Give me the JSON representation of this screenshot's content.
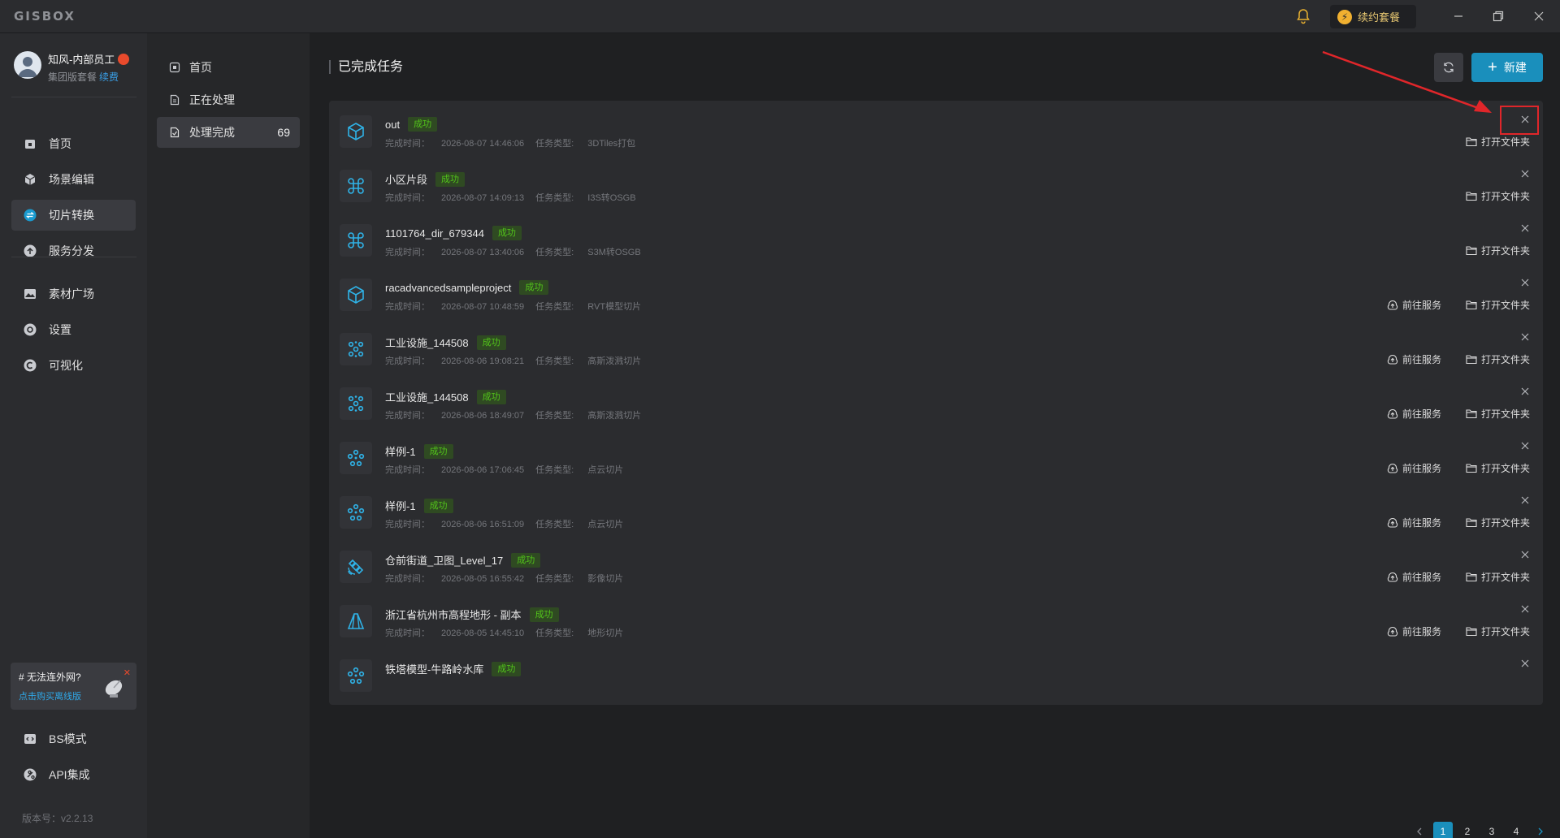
{
  "app": {
    "logo": "GISBOX",
    "renew_label": "续约套餐"
  },
  "user": {
    "name": "知风-内部员工",
    "plan": "集团版套餐",
    "renew_link": "续费"
  },
  "nav": {
    "items": [
      {
        "label": "首页",
        "icon": "home-icon"
      },
      {
        "label": "场景编辑",
        "icon": "cube-icon"
      },
      {
        "label": "切片转换",
        "icon": "convert-icon",
        "active": true
      },
      {
        "label": "服务分发",
        "icon": "upload-icon"
      },
      {
        "label": "素材广场",
        "icon": "image-icon"
      },
      {
        "label": "设置",
        "icon": "gear-icon"
      },
      {
        "label": "可视化",
        "icon": "visual-icon"
      }
    ],
    "bottom_items": [
      {
        "label": "BS模式",
        "icon": "code-icon"
      },
      {
        "label": "API集成",
        "icon": "api-icon"
      }
    ],
    "offline": {
      "title": "# 无法连外网?",
      "link": "点击购买离线版"
    },
    "version": "版本号：v2.2.13"
  },
  "subnav": {
    "items": [
      {
        "label": "首页"
      },
      {
        "label": "正在处理"
      },
      {
        "label": "处理完成",
        "count": "69",
        "active": true
      }
    ]
  },
  "main": {
    "title": "已完成任务",
    "new_label": "新建",
    "open_folder_label": "打开文件夹",
    "go_service_label": "前往服务",
    "status_label": "成功",
    "time_prefix": "完成时间：",
    "type_prefix": "任务类型: ",
    "accent": "#1a8fbc",
    "success_color": "#52c41a"
  },
  "tasks": [
    {
      "name": "out",
      "time": "2026-08-07 14:46:06",
      "type": "3DTiles打包",
      "icon": "cube-icon",
      "service": false
    },
    {
      "name": "小区片段",
      "time": "2026-08-07 14:09:13",
      "type": "I3S转OSGB",
      "icon": "command-icon",
      "service": false
    },
    {
      "name": "1101764_dir_679344",
      "time": "2026-08-07 13:40:06",
      "type": "S3M转OSGB",
      "icon": "command-icon",
      "service": false
    },
    {
      "name": "racadvancedsampleproject",
      "time": "2026-08-07 10:48:59",
      "type": "RVT模型切片",
      "icon": "cube-icon",
      "service": true
    },
    {
      "name": "工业设施_144508",
      "time": "2026-08-06 19:08:21",
      "type": "高斯泼溅切片",
      "icon": "gaussian-icon",
      "service": true
    },
    {
      "name": "工业设施_144508",
      "time": "2026-08-06 18:49:07",
      "type": "高斯泼溅切片",
      "icon": "gaussian-icon",
      "service": true
    },
    {
      "name": "样例-1",
      "time": "2026-08-06 17:06:45",
      "type": "点云切片",
      "icon": "pointcloud-icon",
      "service": true
    },
    {
      "name": "样例-1",
      "time": "2026-08-06 16:51:09",
      "type": "点云切片",
      "icon": "pointcloud-icon",
      "service": true
    },
    {
      "name": "仓前街道_卫图_Level_17",
      "time": "2026-08-05 16:55:42",
      "type": "影像切片",
      "icon": "satellite-icon",
      "service": true
    },
    {
      "name": "浙江省杭州市高程地形 - 副本",
      "time": "2026-08-05 14:45:10",
      "type": "地形切片",
      "icon": "terrain-icon",
      "service": true
    },
    {
      "name": "铁塔模型-牛路岭水库",
      "time": "",
      "type": "",
      "icon": "pointcloud-icon",
      "service": false
    }
  ],
  "pagination": {
    "pages": [
      "1",
      "2",
      "3",
      "4"
    ],
    "current": "1"
  }
}
